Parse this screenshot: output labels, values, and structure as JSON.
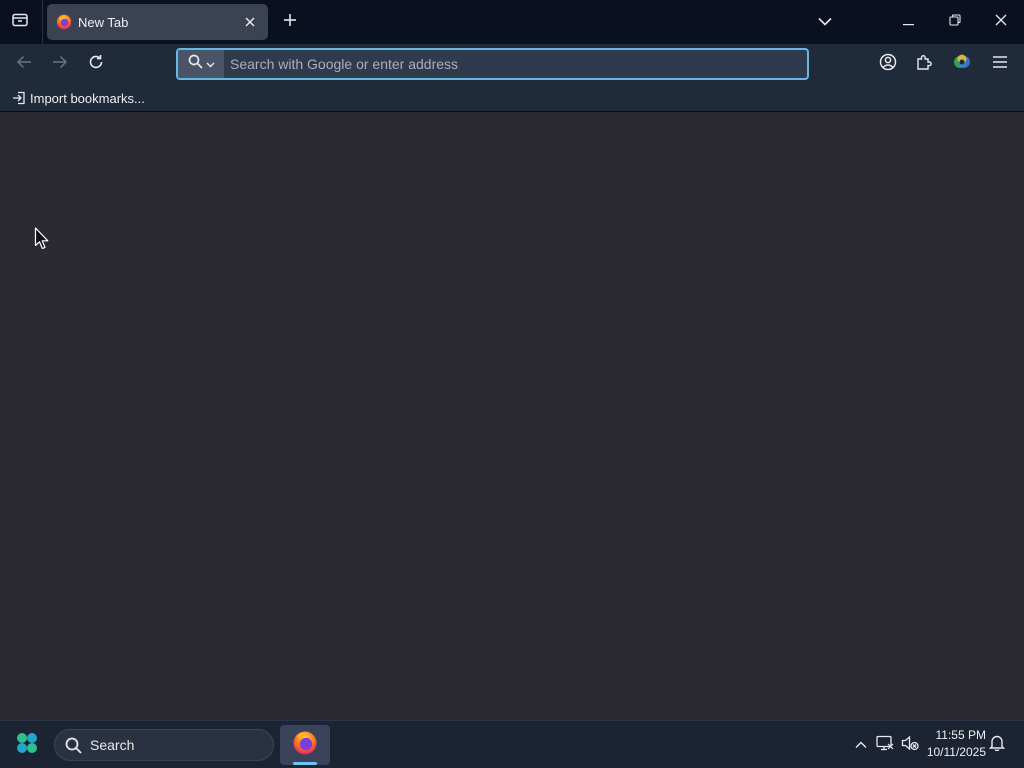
{
  "tabstrip": {
    "active_tab": {
      "title": "New Tab"
    }
  },
  "navbar": {
    "url_placeholder": "Search with Google or enter address"
  },
  "bookmarks": {
    "items": [
      {
        "label": "Import bookmarks..."
      }
    ]
  },
  "taskbar": {
    "search_label": "Search",
    "clock": {
      "time": "11:55 PM",
      "date": "10/11/2025"
    }
  },
  "colors": {
    "tabstrip_bg": "#0b1020",
    "toolbar_bg": "#1f2a3a",
    "content_bg": "#2b2a33",
    "urlbar_focus": "#64b9e4",
    "taskbar_bg": "#1c2433"
  },
  "icons": {
    "tab_overview": "tab-overview-icon",
    "favicon": "firefox-icon",
    "close_tab": "close-icon",
    "new_tab": "plus-icon",
    "tabs_list": "chevron-down-icon",
    "minimize": "minimize-icon",
    "restore": "restore-icon",
    "close_window": "close-icon",
    "back": "arrow-left-icon",
    "forward": "arrow-right-icon",
    "reload": "reload-icon",
    "search_engine": "search-icon",
    "account": "account-icon",
    "extensions": "puzzle-icon",
    "profile": "profile-icon",
    "menu": "hamburger-menu-icon",
    "import": "import-icon",
    "start": "windows-start-icon",
    "tray_overflow": "chevron-up-icon",
    "network": "network-icon",
    "volume": "volume-muted-icon",
    "notifications": "bell-icon"
  }
}
